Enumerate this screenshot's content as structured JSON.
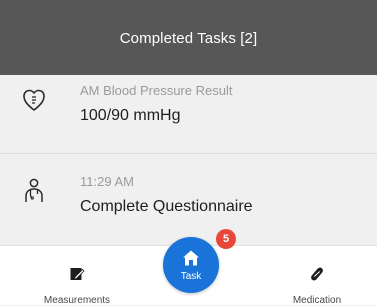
{
  "header": {
    "title": "Completed Tasks [2]"
  },
  "tasks": [
    {
      "icon": "heart-gauge-icon",
      "subtitle": "AM Blood Pressure Result",
      "title": "100/90 mmHg"
    },
    {
      "icon": "doctor-icon",
      "subtitle": "11:29 AM",
      "title": "Complete Questionnaire"
    }
  ],
  "bottom_nav": {
    "left_label": "Measurements",
    "center_label": "Task",
    "center_badge": "5",
    "right_label": "Medication"
  },
  "colors": {
    "header_bg": "#575757",
    "accent": "#1a73d9",
    "badge": "#e8473b"
  }
}
